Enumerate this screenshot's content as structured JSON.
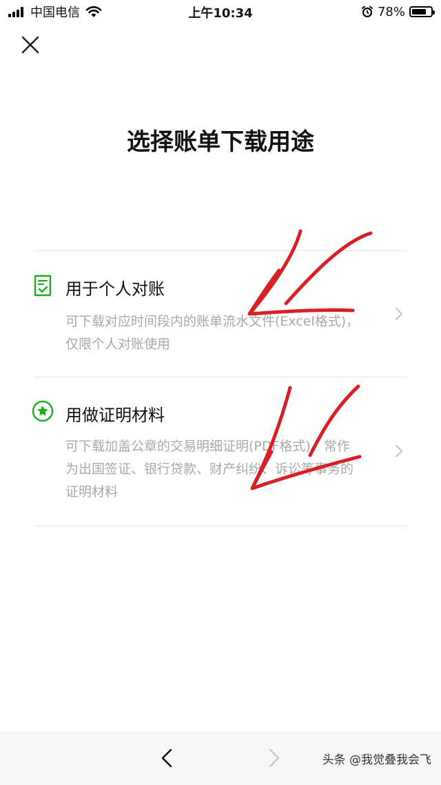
{
  "status_bar": {
    "carrier": "中国电信",
    "time": "上午10:34",
    "battery": "78%",
    "battery_level": 0.78
  },
  "header": {
    "close_icon": "close-icon"
  },
  "page": {
    "title": "选择账单下载用途"
  },
  "options": [
    {
      "icon": "document-check-icon",
      "title": "用于个人对账",
      "description": "可下载对应时间段内的账单流水文件(Excel格式)，仅限个人对账使用"
    },
    {
      "icon": "star-badge-icon",
      "title": "用做证明材料",
      "description": "可下载加盖公章的交易明细证明(PDF格式)，常作为出国签证、银行贷款、财产纠纷、诉讼等事务的证明材料"
    }
  ],
  "colors": {
    "accent_green": "#1aad19",
    "annotation_red": "#d91f26",
    "description_gray": "#a8a8a8"
  },
  "bottom_bar": {
    "back_icon": "chevron-left-icon",
    "forward_icon": "chevron-right-icon",
    "watermark": "头条 @我觉叠我会飞"
  }
}
